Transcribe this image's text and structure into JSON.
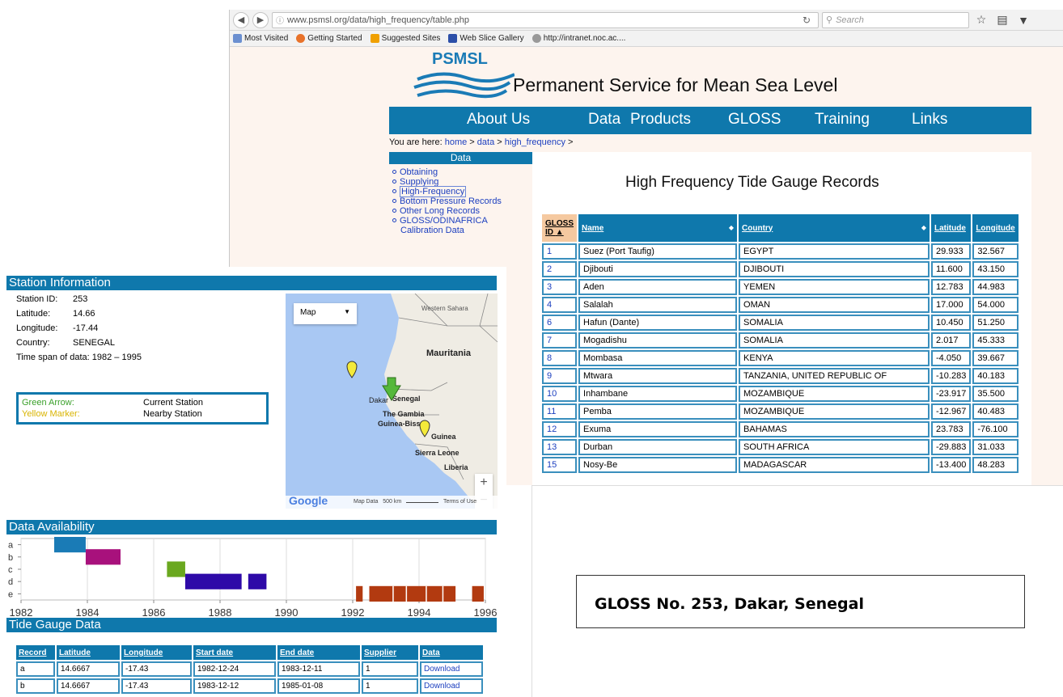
{
  "browser": {
    "url": "www.psmsl.org/data/high_frequency/table.php",
    "search_placeholder": "Search",
    "bookmarks": [
      "Most Visited",
      "Getting Started",
      "Suggested Sites",
      "Web Slice Gallery",
      "http://intranet.noc.ac...."
    ]
  },
  "site": {
    "logo_text": "PSMSL",
    "title": "Permanent Service for Mean Sea Level",
    "nav": [
      "About Us",
      "Data",
      "Products",
      "GLOSS",
      "Training",
      "Links"
    ],
    "breadcrumb_prefix": "You are here:",
    "breadcrumb": [
      "home",
      "data",
      "high_frequency"
    ],
    "sidebar_title": "Data",
    "sidebar_items": [
      "Obtaining",
      "Supplying",
      "High-Frequency",
      "Bottom Pressure Records",
      "Other Long Records",
      "GLOSS/ODINAFRICA",
      "Calibration Data"
    ],
    "page_heading": "High Frequency Tide Gauge Records"
  },
  "hf_table": {
    "headers": [
      "GLOSS ID",
      "Name",
      "Country",
      "Latitude",
      "Longitude"
    ],
    "rows": [
      [
        "1",
        "Suez (Port Taufig)",
        "EGYPT",
        "29.933",
        "32.567"
      ],
      [
        "2",
        "Djibouti",
        "DJIBOUTI",
        "11.600",
        "43.150"
      ],
      [
        "3",
        "Aden",
        "YEMEN",
        "12.783",
        "44.983"
      ],
      [
        "4",
        "Salalah",
        "OMAN",
        "17.000",
        "54.000"
      ],
      [
        "6",
        "Hafun (Dante)",
        "SOMALIA",
        "10.450",
        "51.250"
      ],
      [
        "7",
        "Mogadishu",
        "SOMALIA",
        "2.017",
        "45.333"
      ],
      [
        "8",
        "Mombasa",
        "KENYA",
        "-4.050",
        "39.667"
      ],
      [
        "9",
        "Mtwara",
        "TANZANIA, UNITED REPUBLIC OF",
        "-10.283",
        "40.183"
      ],
      [
        "10",
        "Inhambane",
        "MOZAMBIQUE",
        "-23.917",
        "35.500"
      ],
      [
        "11",
        "Pemba",
        "MOZAMBIQUE",
        "-12.967",
        "40.483"
      ],
      [
        "12",
        "Exuma",
        "BAHAMAS",
        "23.783",
        "-76.100"
      ],
      [
        "13",
        "Durban",
        "SOUTH AFRICA",
        "-29.883",
        "31.033"
      ],
      [
        "15",
        "Nosy-Be",
        "MADAGASCAR",
        "-13.400",
        "48.283"
      ]
    ]
  },
  "station": {
    "title": "Station Information",
    "fields": [
      {
        "k": "Station ID:",
        "v": "253"
      },
      {
        "k": "Latitude:",
        "v": "14.66"
      },
      {
        "k": "Longitude:",
        "v": "-17.44"
      },
      {
        "k": "Country:",
        "v": "SENEGAL"
      }
    ],
    "time_span_label": "Time span of data:",
    "time_span": "1982 – 1995",
    "legend": [
      {
        "k": "Green Arrow:",
        "v": "Current Station",
        "color": "#3aa02a"
      },
      {
        "k": "Yellow Marker:",
        "v": "Nearby Station",
        "color": "#d9b400"
      }
    ]
  },
  "map": {
    "type_label": "Map",
    "labels": [
      "Western Sahara",
      "Mauritania",
      "Dakar",
      "Senegal",
      "The Gambia",
      "Guinea-Bissau",
      "Guinea",
      "Sierra Leone",
      "Liberia"
    ],
    "footer": [
      "Map Data",
      "500 km",
      "Terms of Use"
    ],
    "google": "Google"
  },
  "availability": {
    "title": "Data Availability"
  },
  "chart_data": {
    "type": "bar",
    "title": "Data Availability",
    "categories": [
      "a",
      "b",
      "c",
      "d",
      "e"
    ],
    "xlim": [
      1982,
      1996
    ],
    "xticks": [
      1982,
      1984,
      1986,
      1988,
      1990,
      1992,
      1994,
      1996
    ],
    "series": [
      {
        "name": "a",
        "color": "#1a7bb6",
        "ranges": [
          [
            1983.0,
            1983.95
          ]
        ]
      },
      {
        "name": "b",
        "color": "#a8117c",
        "ranges": [
          [
            1983.95,
            1985.0
          ]
        ]
      },
      {
        "name": "c",
        "color": "#6aa81f",
        "ranges": [
          [
            1986.4,
            1986.95
          ]
        ]
      },
      {
        "name": "d",
        "color": "#2e0aa8",
        "ranges": [
          [
            1986.95,
            1988.65
          ],
          [
            1988.85,
            1989.4
          ]
        ]
      },
      {
        "name": "e",
        "color": "#b23a10",
        "ranges": [
          [
            1992.1,
            1992.3
          ],
          [
            1992.5,
            1995.1
          ],
          [
            1995.6,
            1995.95
          ]
        ]
      }
    ]
  },
  "tide": {
    "title": "Tide Gauge Data",
    "headers": [
      "Record",
      "Latitude",
      "Longitude",
      "Start date",
      "End date",
      "Supplier",
      "Data"
    ],
    "rows": [
      [
        "a",
        "14.6667",
        "-17.43",
        "1982-12-24",
        "1983-12-11",
        "1",
        "Download"
      ],
      [
        "b",
        "14.6667",
        "-17.43",
        "1983-12-12",
        "1985-01-08",
        "1",
        "Download"
      ]
    ]
  },
  "caption": "GLOSS No. 253, Dakar, Senegal"
}
